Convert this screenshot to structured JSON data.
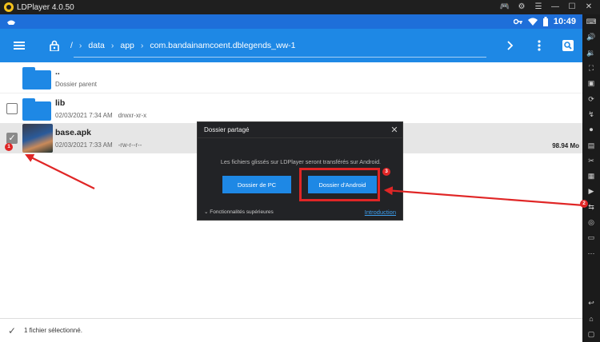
{
  "window": {
    "title": "LDPlayer 4.0.50"
  },
  "statusbar": {
    "time": "10:49"
  },
  "toolbar": {
    "crumbs": [
      "/",
      "data",
      "app",
      "com.bandainamcoent.dblegends_ww-1"
    ]
  },
  "files": [
    {
      "name": "..",
      "meta_date": "Dossier parent",
      "meta_perm": "",
      "size": "",
      "checked": false,
      "type": "folder"
    },
    {
      "name": "lib",
      "meta_date": "02/03/2021 7:34 AM",
      "meta_perm": "drwxr-xr-x",
      "size": "",
      "checked": false,
      "type": "folder"
    },
    {
      "name": "base.apk",
      "meta_date": "02/03/2021 7:33 AM",
      "meta_perm": "-rw-r--r--",
      "size": "98.94 Mo",
      "checked": true,
      "type": "apk"
    }
  ],
  "bottombar": {
    "status": "1 fichier sélectionné."
  },
  "dialog": {
    "title": "Dossier partagé",
    "message": "Les fichiers glissés sur LDPlayer seront transférés sur Android.",
    "btn_pc": "Dossier de PC",
    "btn_android": "Dossier d'Android",
    "advanced": "Fonctionnalités supérieures",
    "intro": "Introduction"
  },
  "annotations": {
    "badge1": "1",
    "badge2": "2",
    "badge3": "3",
    "color": "#e02626"
  },
  "colors": {
    "accent": "#1e88e5",
    "statusbar": "#1e6fd9"
  },
  "icons": [
    "menu-icon",
    "lock-icon",
    "chevron-right-icon",
    "more-vert-icon",
    "search-icon",
    "gamepad-icon",
    "key-icon",
    "wifi-icon",
    "battery-icon"
  ]
}
